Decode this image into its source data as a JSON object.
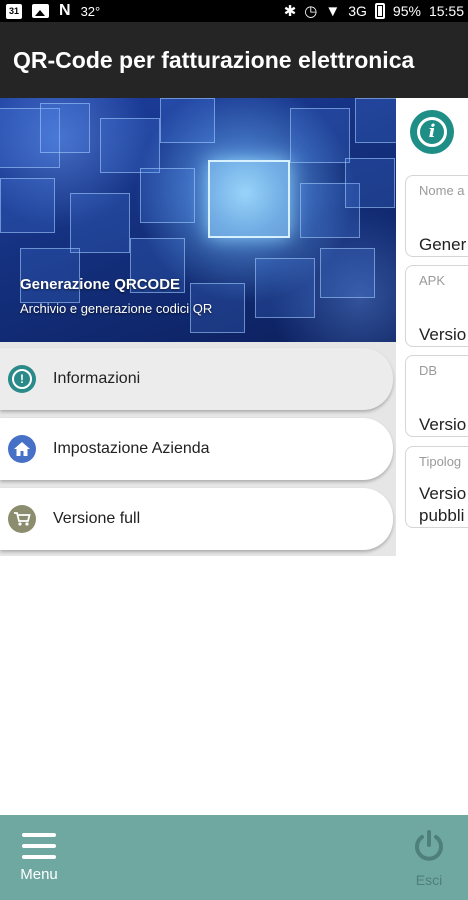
{
  "status_bar": {
    "calendar_day": "31",
    "n_badge": "N",
    "temperature": "32°",
    "bluetooth_glyph": "✱",
    "alarm_glyph": "◷",
    "wifi_glyph": "▼",
    "network": "3G",
    "battery": "95%",
    "time": "15:55"
  },
  "app_bar": {
    "title": "QR-Code per fatturazione elettronica"
  },
  "drawer": {
    "header_title": "Generazione QRCODE",
    "header_subtitle": "Archivio e generazione codici QR",
    "items": [
      {
        "label": "Informazioni",
        "icon": "info-icon",
        "active": true
      },
      {
        "label": "Impostazione Azienda",
        "icon": "home-icon"
      },
      {
        "label": "Versione full",
        "icon": "cart-icon"
      }
    ]
  },
  "right_panel": {
    "icon": "info-icon",
    "cards": [
      {
        "label": "Nome a",
        "value": "Gener"
      },
      {
        "label": "APK",
        "value": "Versio"
      },
      {
        "label": "DB",
        "value": "Versio"
      },
      {
        "label": "Tipolog",
        "value": "Versio",
        "value2": "pubbli"
      }
    ]
  },
  "bottom_bar": {
    "menu_label": "Menu",
    "exit_label": "Esci"
  },
  "colors": {
    "app_bar": "#252525",
    "bottom_bar": "#6fa7a1",
    "info_accent": "#1f8e86",
    "exit_disabled": "#4f7f7a"
  }
}
